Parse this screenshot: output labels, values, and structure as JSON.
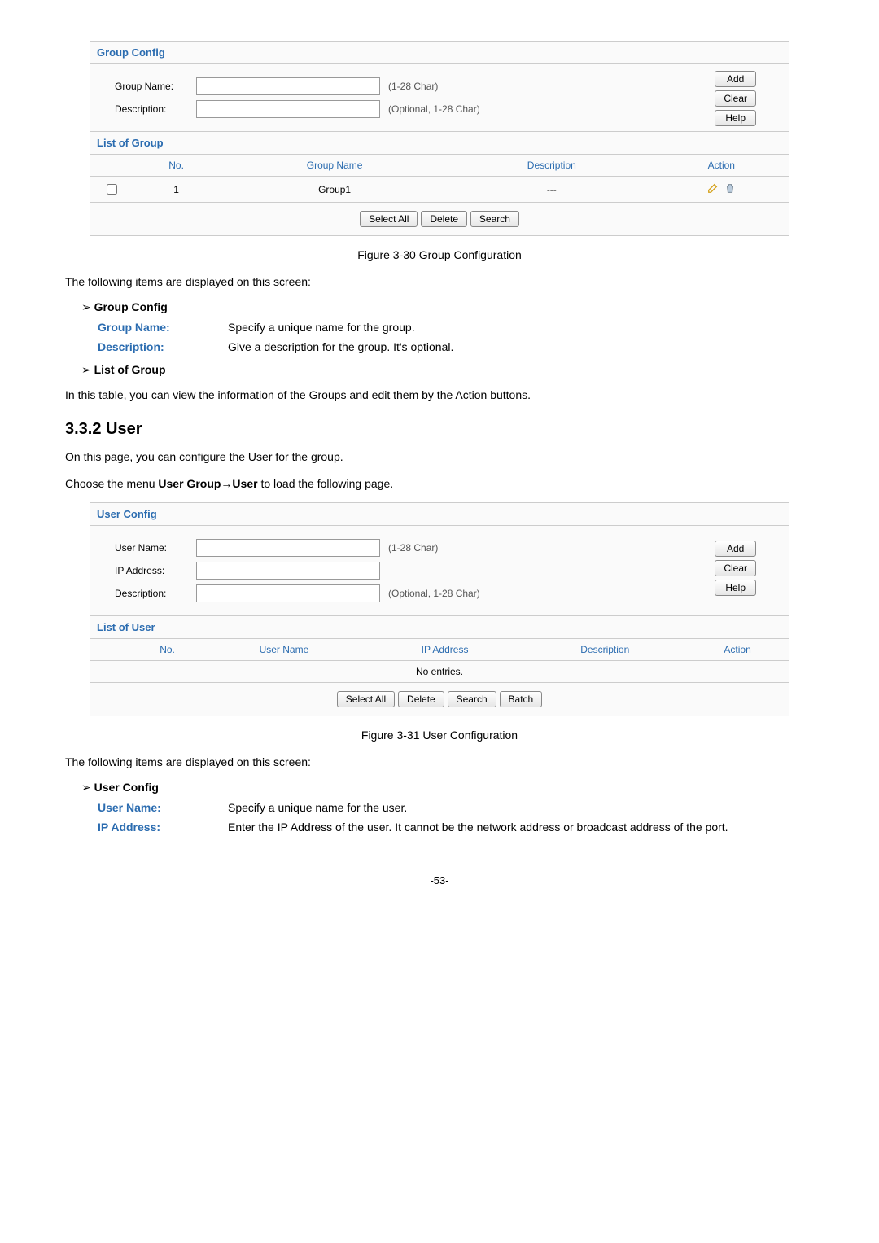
{
  "groupPanel": {
    "header": "Group Config",
    "rows": {
      "groupNameLabel": "Group Name:",
      "groupNameHint": "(1-28 Char)",
      "descLabel": "Description:",
      "descHint": "(Optional, 1-28 Char)"
    },
    "buttons": {
      "add": "Add",
      "clear": "Clear",
      "help": "Help"
    },
    "listHeader": "List of Group",
    "cols": {
      "no": "No.",
      "name": "Group Name",
      "desc": "Description",
      "action": "Action"
    },
    "row1": {
      "no": "1",
      "name": "Group1",
      "desc": "---"
    },
    "bottomBtns": {
      "selectAll": "Select All",
      "delete": "Delete",
      "search": "Search"
    }
  },
  "caption1": "Figure 3-30 Group Configuration",
  "text1": "The following items are displayed on this screen:",
  "sec1": {
    "head": "Group Config",
    "name": {
      "label": "Group Name:",
      "text": "Specify a unique name for the group."
    },
    "desc": {
      "label": "Description:",
      "text": "Give a description for the group. It's optional."
    }
  },
  "sec2": {
    "head": "List of Group",
    "text": "In this table, you can view the information of the Groups and edit them by the Action buttons."
  },
  "h2": "3.3.2   User",
  "text3": "On this page, you can configure the User for the group.",
  "text4a": "Choose the menu ",
  "text4b": "User Group→User",
  "text4c": " to load the following page.",
  "userPanel": {
    "header": "User Config",
    "rows": {
      "userNameLabel": "User Name:",
      "userNameHint": "(1-28 Char)",
      "ipLabel": "IP Address:",
      "descLabel": "Description:",
      "descHint": "(Optional, 1-28 Char)"
    },
    "buttons": {
      "add": "Add",
      "clear": "Clear",
      "help": "Help"
    },
    "listHeader": "List of User",
    "cols": {
      "no": "No.",
      "name": "User Name",
      "ip": "IP Address",
      "desc": "Description",
      "action": "Action"
    },
    "noEntries": "No entries.",
    "bottomBtns": {
      "selectAll": "Select All",
      "delete": "Delete",
      "search": "Search",
      "batch": "Batch"
    }
  },
  "caption2": "Figure 3-31 User Configuration",
  "text5": "The following items are displayed on this screen:",
  "sec3": {
    "head": "User Config",
    "name": {
      "label": "User Name:",
      "text": "Specify a unique name for the user."
    },
    "ip": {
      "label": "IP Address:",
      "text": "Enter the IP Address of the user. It cannot be the network address or broadcast address of the port."
    }
  },
  "pageNum": "-53-"
}
